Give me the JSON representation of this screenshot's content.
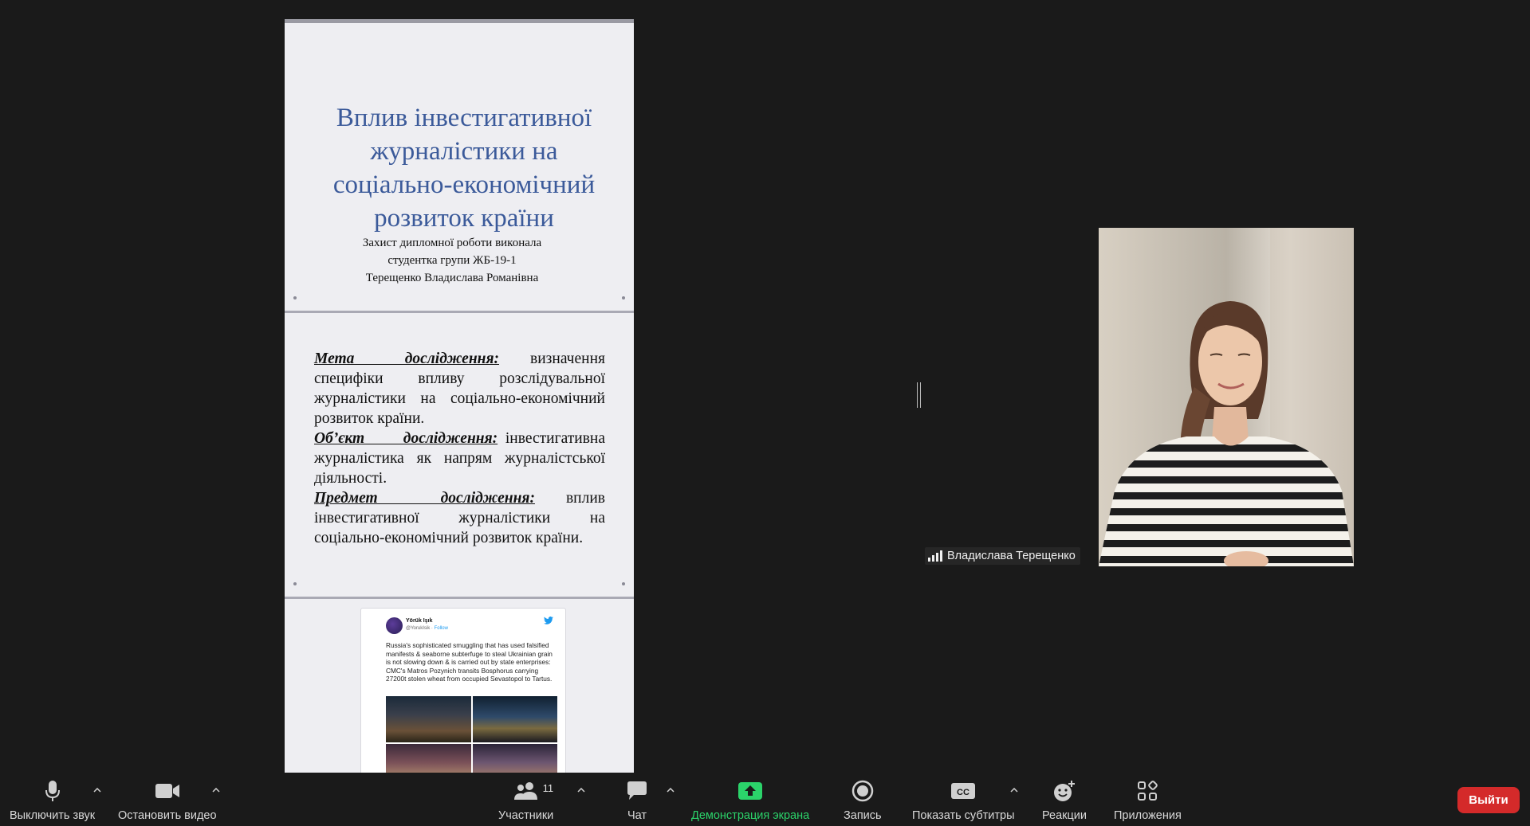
{
  "shared_doc": {
    "slide1": {
      "title": "Вплив інвестигативної журналістики на соціально-економічний розвиток країни",
      "subtitle_lines": [
        "Захист дипломної роботи виконала",
        "студентка групи ЖБ-19-1",
        "Терещенко Владислава Романівна"
      ]
    },
    "slide2": {
      "aim_term": "Мета дослідження:",
      "aim_text": "визначення специфіки впливу розслідувальної журналістики на соціально-економічний розвиток країни.",
      "object_term": "Об’єкт дослідження:",
      "object_text": "інвестигативна журналістика як напрям журналістської діяльності.",
      "subject_term": "Предмет дослідження:",
      "subject_text": "вплив інвестигативної журналістики на соціально-економічний розвиток країни."
    },
    "slide3": {
      "tweet": {
        "author": "Yörük Işık",
        "handle": "@YorukIsik",
        "follow": "Follow",
        "text": "Russia's sophisticated smuggling that has used falsified manifests & seaborne subterfuge to steal Ukrainian grain is not slowing down & is carried out by state enterprises: CMC's Matros Pozynich transits Bosphorus carrying 27200t stolen wheat from occupied Sevastopol to Tartus."
      }
    }
  },
  "participant": {
    "name": "Владислава Терещенко"
  },
  "toolbar": {
    "mute_label": "Выключить звук",
    "video_label": "Остановить видео",
    "participants_label": "Участники",
    "participants_count": "11",
    "chat_label": "Чат",
    "share_label": "Демонстрация экрана",
    "record_label": "Запись",
    "captions_label": "Показать субтитры",
    "reactions_label": "Реакции",
    "apps_label": "Приложения",
    "leave_label": "Выйти"
  },
  "colors": {
    "background": "#1a1a1a",
    "share_green": "#2bd36a",
    "leave_red": "#d42a2a",
    "slide_title_blue": "#3b5a9a"
  }
}
